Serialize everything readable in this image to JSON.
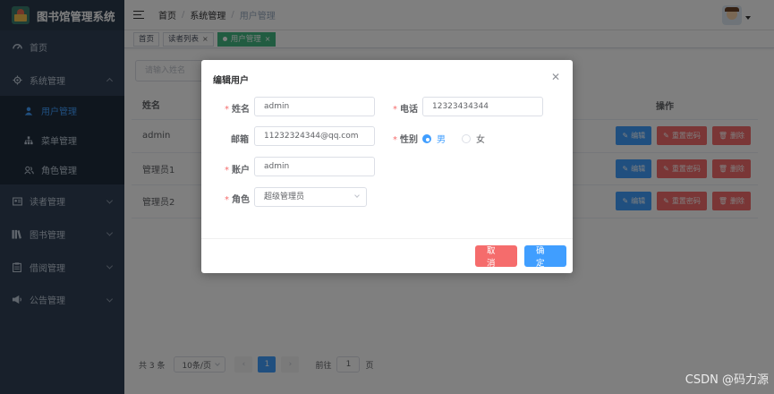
{
  "app": {
    "title": "图书馆管理系统"
  },
  "sidebar": {
    "items": [
      {
        "label": "首页",
        "icon": "dashboard-icon"
      },
      {
        "label": "系统管理",
        "icon": "gear-icon"
      },
      {
        "label": "用户管理",
        "icon": "user-icon"
      },
      {
        "label": "菜单管理",
        "icon": "tree-icon"
      },
      {
        "label": "角色管理",
        "icon": "people-icon"
      },
      {
        "label": "读者管理",
        "icon": "id-card-icon"
      },
      {
        "label": "图书管理",
        "icon": "books-icon"
      },
      {
        "label": "借阅管理",
        "icon": "clipboard-icon"
      },
      {
        "label": "公告管理",
        "icon": "megaphone-icon"
      }
    ]
  },
  "navbar": {
    "breadcrumb": [
      "首页",
      "系统管理",
      "用户管理"
    ],
    "separator": "/"
  },
  "tags": {
    "items": [
      {
        "label": "首页"
      },
      {
        "label": "读者列表"
      },
      {
        "label": "用户管理"
      }
    ],
    "close_glyph": "×"
  },
  "search": {
    "placeholder": "请输入姓名"
  },
  "table": {
    "headers": {
      "name": "姓名",
      "operations": "操作"
    },
    "rows": [
      {
        "name": "admin"
      },
      {
        "name": "管理员1"
      },
      {
        "name": "管理员2"
      }
    ],
    "actions": {
      "edit": "编辑",
      "reset": "重置密码",
      "delete": "删除"
    }
  },
  "pagination": {
    "total": "共 3 条",
    "page_size": "10条/页",
    "current_page": "1",
    "jump_prefix": "前往",
    "jump_value": "1",
    "jump_suffix": "页"
  },
  "dialog": {
    "title": "编辑用户",
    "fields": {
      "name": {
        "label": "姓名",
        "value": "admin"
      },
      "phone": {
        "label": "电话",
        "value": "12323434344"
      },
      "email": {
        "label": "邮箱",
        "value": "11232324344@qq.com"
      },
      "gender": {
        "label": "性别",
        "options": [
          "男",
          "女"
        ],
        "selected": "男"
      },
      "account": {
        "label": "账户",
        "value": "admin"
      },
      "role": {
        "label": "角色",
        "value": "超级管理员"
      }
    },
    "required_mark": "*",
    "cancel_label": "取消",
    "ok_label": "确定"
  },
  "watermark": "CSDN @码力源",
  "colors": {
    "primary": "#409eff",
    "danger": "#f56c6c",
    "success": "#42b983",
    "sidebar": "#304156"
  }
}
